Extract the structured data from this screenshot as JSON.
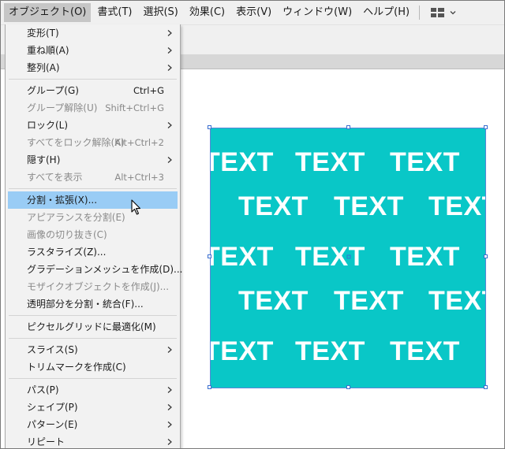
{
  "menubar": {
    "items": [
      {
        "label": "オブジェクト(O)",
        "active": true
      },
      {
        "label": "書式(T)"
      },
      {
        "label": "選択(S)"
      },
      {
        "label": "効果(C)"
      },
      {
        "label": "表示(V)"
      },
      {
        "label": "ウィンドウ(W)"
      },
      {
        "label": "ヘルプ(H)"
      }
    ],
    "workspace_icon": "grid-layout-icon",
    "workspace_chevron": "chevron-down-icon"
  },
  "object_menu": {
    "items": [
      {
        "label": "変形(T)",
        "submenu": true
      },
      {
        "label": "重ね順(A)",
        "submenu": true
      },
      {
        "label": "整列(A)",
        "submenu": true
      },
      {
        "label": "グループ(G)",
        "shortcut": "Ctrl+G"
      },
      {
        "label": "グループ解除(U)",
        "shortcut": "Shift+Ctrl+G",
        "disabled": true
      },
      {
        "label": "ロック(L)",
        "submenu": true
      },
      {
        "label": "すべてをロック解除(K)",
        "shortcut": "Alt+Ctrl+2",
        "disabled": true
      },
      {
        "label": "隠す(H)",
        "submenu": true
      },
      {
        "label": "すべてを表示",
        "shortcut": "Alt+Ctrl+3",
        "disabled": true
      },
      {
        "label": "分割・拡張(X)...",
        "highlighted": true
      },
      {
        "label": "アピアランスを分割(E)",
        "disabled": true
      },
      {
        "label": "画像の切り抜き(C)",
        "disabled": true
      },
      {
        "label": "ラスタライズ(Z)..."
      },
      {
        "label": "グラデーションメッシュを作成(D)..."
      },
      {
        "label": "モザイクオブジェクトを作成(J)...",
        "disabled": true
      },
      {
        "label": "透明部分を分割・統合(F)..."
      },
      {
        "label": "ピクセルグリッドに最適化(M)"
      },
      {
        "label": "スライス(S)",
        "submenu": true
      },
      {
        "label": "トリムマークを作成(C)"
      },
      {
        "label": "パス(P)",
        "submenu": true
      },
      {
        "label": "シェイプ(P)",
        "submenu": true
      },
      {
        "label": "パターン(E)",
        "submenu": true
      },
      {
        "label": "リピート",
        "submenu": true
      }
    ]
  },
  "artwork": {
    "fill_color": "#09c7c7",
    "text_color": "#ffffff",
    "pattern_text": "TEXT",
    "selection_color": "#3b6fd0"
  }
}
